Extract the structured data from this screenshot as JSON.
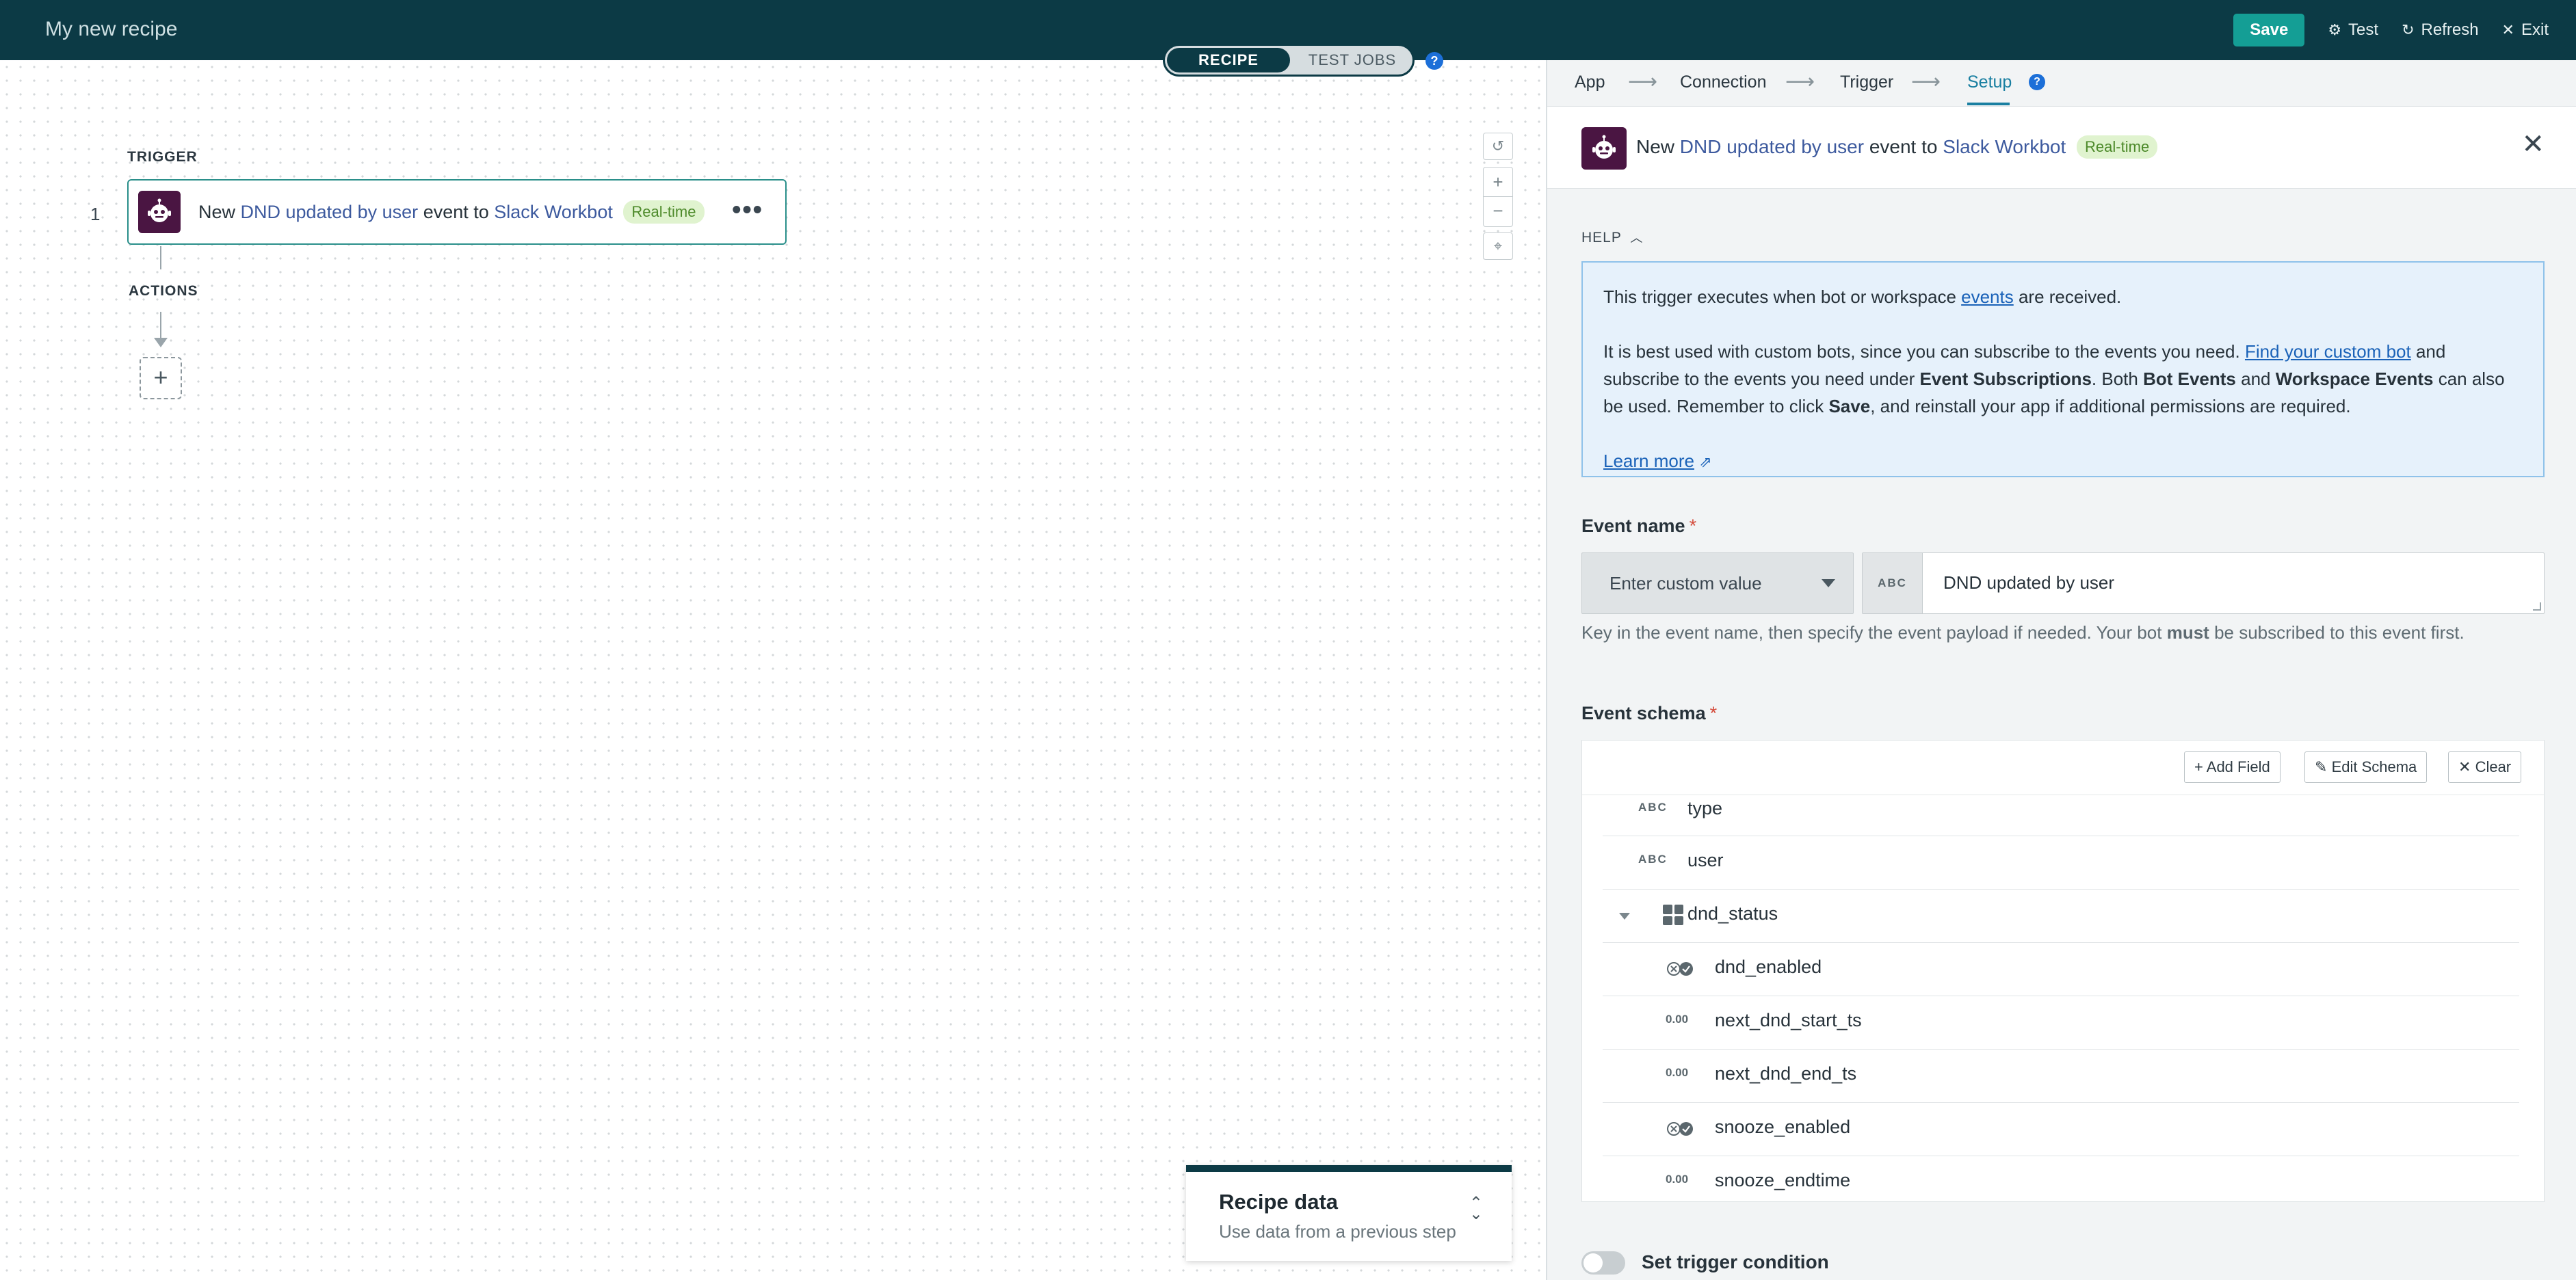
{
  "app": {
    "title": "My new recipe",
    "actions": {
      "save": "Save",
      "test": "Test",
      "refresh": "Refresh",
      "exit": "Exit"
    }
  },
  "mode_toggle": {
    "recipe": "RECIPE",
    "test_jobs": "TEST JOBS",
    "help": "?"
  },
  "canvas": {
    "trigger_label": "TRIGGER",
    "actions_label": "ACTIONS",
    "step_number": "1",
    "trigger_card": {
      "prefix": "New",
      "event": "DND updated by user",
      "middle": "event to",
      "app": "Slack Workbot",
      "badge": "Real-time",
      "more": "•••"
    },
    "add_step": "+"
  },
  "recipe_data": {
    "title": "Recipe data",
    "subtitle": "Use data from a previous step"
  },
  "panel": {
    "steps": [
      {
        "label": "App"
      },
      {
        "label": "Connection"
      },
      {
        "label": "Trigger"
      },
      {
        "label": "Setup"
      }
    ],
    "step_help": "?",
    "header": {
      "prefix": "New",
      "event": "DND updated by user",
      "middle": "event to",
      "app": "Slack Workbot",
      "badge": "Real-time"
    },
    "help": {
      "label": "HELP",
      "p1_start": "This trigger executes when bot or workspace ",
      "p1_link": "events",
      "p1_end": " are received.",
      "p2_start": "It is best used with custom bots, since you can subscribe to the events you need. ",
      "p2_link": "Find your custom bot",
      "p2_mid1": " and subscribe to the events you need under ",
      "p2_b1": "Event Subscriptions",
      "p2_mid2": ". Both ",
      "p2_b2": "Bot Events",
      "p2_mid3": " and ",
      "p2_b3": "Workspace Events",
      "p2_mid4": " can also be used. Remember to click ",
      "p2_b4": "Save",
      "p2_end": ", and reinstall your app if additional permissions are required.",
      "learn_more": "Learn more"
    },
    "event_name": {
      "label": "Event name",
      "required": "*",
      "dropdown_value": "Enter custom value",
      "type_tag": "ABC",
      "value": "DND updated by user",
      "hint_start": "Key in the event name, then specify the event payload if needed. Your bot ",
      "hint_bold": "must",
      "hint_end": " be subscribed to this event first."
    },
    "event_schema": {
      "label": "Event schema",
      "required": "*",
      "buttons": {
        "add": "Add Field",
        "edit": "Edit Schema",
        "clear": "Clear"
      },
      "fields": [
        {
          "tag": "ABC",
          "name": "type"
        },
        {
          "tag": "ABC",
          "name": "user"
        },
        {
          "tag": "object",
          "name": "dnd_status"
        },
        {
          "tag": "bool",
          "name": "dnd_enabled"
        },
        {
          "tag": "0.00",
          "name": "next_dnd_start_ts"
        },
        {
          "tag": "0.00",
          "name": "next_dnd_end_ts"
        },
        {
          "tag": "bool",
          "name": "snooze_enabled"
        },
        {
          "tag": "0.00",
          "name": "snooze_endtime"
        }
      ]
    },
    "trigger_condition": {
      "label": "Set trigger condition",
      "enabled": false
    }
  }
}
